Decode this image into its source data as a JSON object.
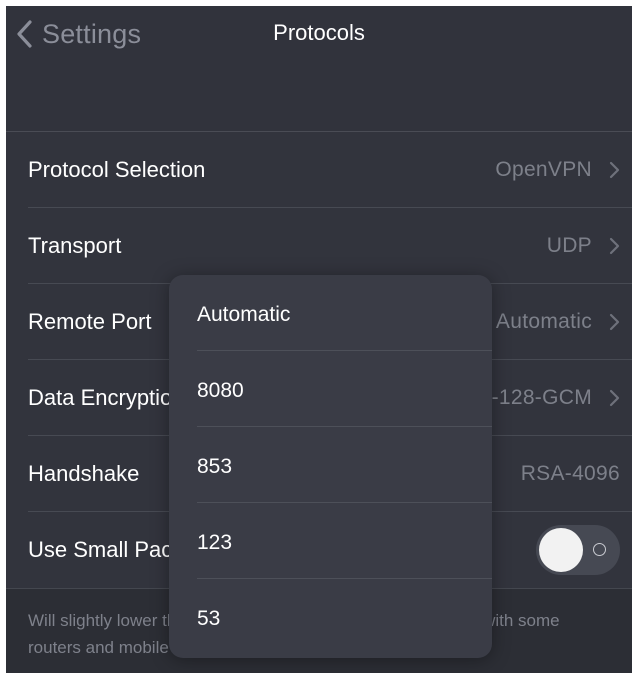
{
  "navbar": {
    "back_label": "Settings",
    "title": "Protocols"
  },
  "rows": [
    {
      "label": "Protocol Selection",
      "value": "OpenVPN"
    },
    {
      "label": "Transport",
      "value": "UDP"
    },
    {
      "label": "Remote Port",
      "value": "Automatic"
    },
    {
      "label": "Data Encryption",
      "value": "AES-128-GCM"
    },
    {
      "label": "Handshake",
      "value": "RSA-4096"
    },
    {
      "label": "Use Small Packets",
      "toggle_on": false
    }
  ],
  "footnote": "Will slightly lower the IP packet size to improve compatibility with some routers and mobile networks.",
  "popover": {
    "options": [
      "Automatic",
      "8080",
      "853",
      "123",
      "53"
    ]
  },
  "colors": {
    "background": "#32343d",
    "popover": "#3a3c46",
    "secondary_text": "#7d808a"
  }
}
